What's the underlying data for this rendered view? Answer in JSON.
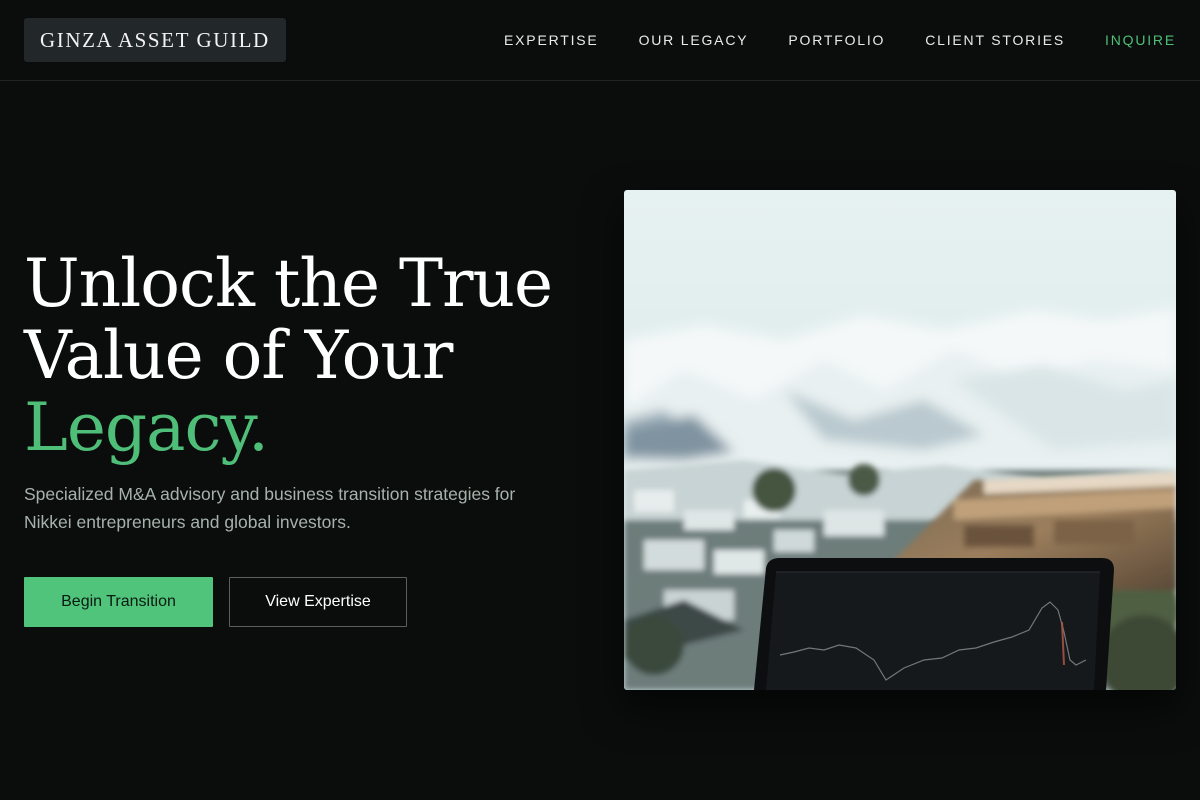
{
  "brand": {
    "name": "GINZA ASSET GUILD"
  },
  "nav": {
    "items": [
      {
        "label": "EXPERTISE"
      },
      {
        "label": "OUR LEGACY"
      },
      {
        "label": "PORTFOLIO"
      },
      {
        "label": "CLIENT STORIES"
      }
    ],
    "cta_label": "INQUIRE"
  },
  "hero": {
    "headline_line1": "Unlock the True",
    "headline_line2": "Value of Your",
    "headline_accent": "Legacy.",
    "subtitle": "Specialized M&A advisory and business transition strategies for Nikkei entrepreneurs and global investors.",
    "primary_button": "Begin Transition",
    "secondary_button": "View Expertise"
  },
  "colors": {
    "background": "#0a0d0c",
    "accent": "#4fbe79",
    "button_primary": "#4fc47a",
    "subtitle_text": "#a7b2ad"
  },
  "image": {
    "icon": "photo-snowy-mountains-with-laptop-chart"
  }
}
